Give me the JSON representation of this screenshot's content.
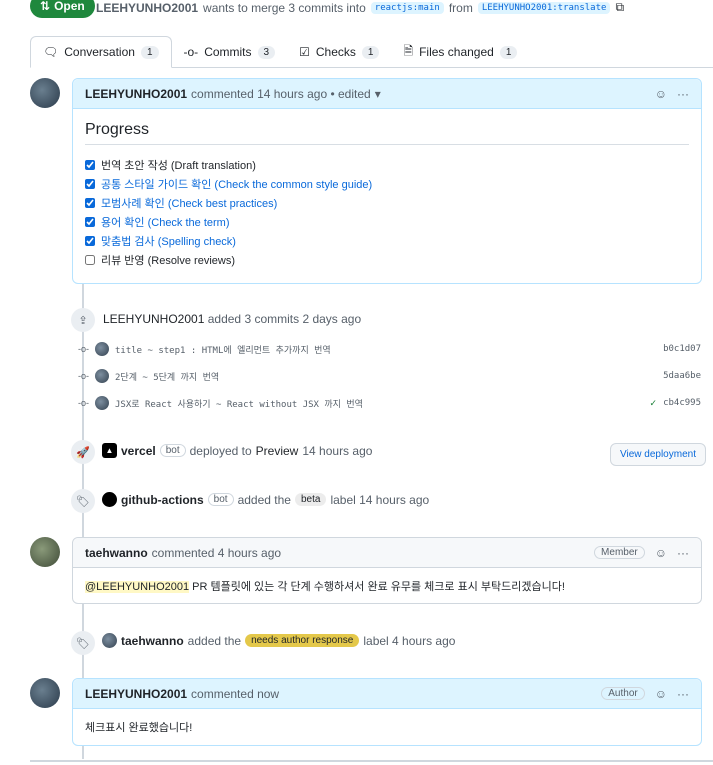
{
  "header": {
    "status": "Open",
    "author": "LEEHYUNHO2001",
    "merge_text": "wants to merge 3 commits into",
    "base": "reactjs:main",
    "from": "from",
    "head": "LEEHYUNHO2001:translate"
  },
  "tabs": [
    {
      "label": "Conversation",
      "count": "1"
    },
    {
      "label": "Commits",
      "count": "3"
    },
    {
      "label": "Checks",
      "count": "1"
    },
    {
      "label": "Files changed",
      "count": "1"
    }
  ],
  "comment1": {
    "author": "LEEHYUNHO2001",
    "meta": "commented 14 hours ago • edited",
    "title": "Progress",
    "items": [
      {
        "text": "번역 초안 작성 (Draft translation)",
        "checked": true,
        "link": false
      },
      {
        "text": "공통 스타일 가이드 확인 (Check the common style guide)",
        "checked": true,
        "link": true
      },
      {
        "text": "모범사례 확인 (Check best practices)",
        "checked": true,
        "link": true
      },
      {
        "text": "용어 확인 (Check the term)",
        "checked": true,
        "link": true
      },
      {
        "text": "맞춤법 검사 (Spelling check)",
        "checked": true,
        "link": true
      },
      {
        "text": "리뷰 반영 (Resolve reviews)",
        "checked": false,
        "link": false
      }
    ]
  },
  "commits_event": {
    "author": "LEEHYUNHO2001",
    "text": "added 3 commits 2 days ago"
  },
  "commits": [
    {
      "msg": "title ~ step1 : HTML에 엘리먼트 추가까지 번역",
      "sha": "b0c1d07"
    },
    {
      "msg": "2단계 ~ 5단계 까지 번역",
      "sha": "5daa6be"
    },
    {
      "msg": "JSX로 React 사용하기 ~ React without JSX 까지 번역",
      "sha": "cb4c995"
    }
  ],
  "deploy": {
    "author": "vercel",
    "bot": "bot",
    "text": "deployed to",
    "env": "Preview",
    "time": "14 hours ago",
    "button": "View deployment"
  },
  "label1": {
    "author": "github-actions",
    "bot": "bot",
    "pre": "added the",
    "label": "beta",
    "post": "label 14 hours ago"
  },
  "comment2": {
    "author": "taehwanno",
    "meta": "commented 4 hours ago",
    "role": "Member",
    "mention": "@LEEHYUNHO2001",
    "body": " PR 템플릿에 있는 각 단계 수행하셔서 완료 유무를 체크로 표시 부탁드리겠습니다!"
  },
  "label2": {
    "author": "taehwanno",
    "pre": "added the",
    "label": "needs author response",
    "post": "label 4 hours ago"
  },
  "comment3": {
    "author": "LEEHYUNHO2001",
    "meta": "commented now",
    "role": "Author",
    "body": "체크표시 완료했습니다!"
  }
}
